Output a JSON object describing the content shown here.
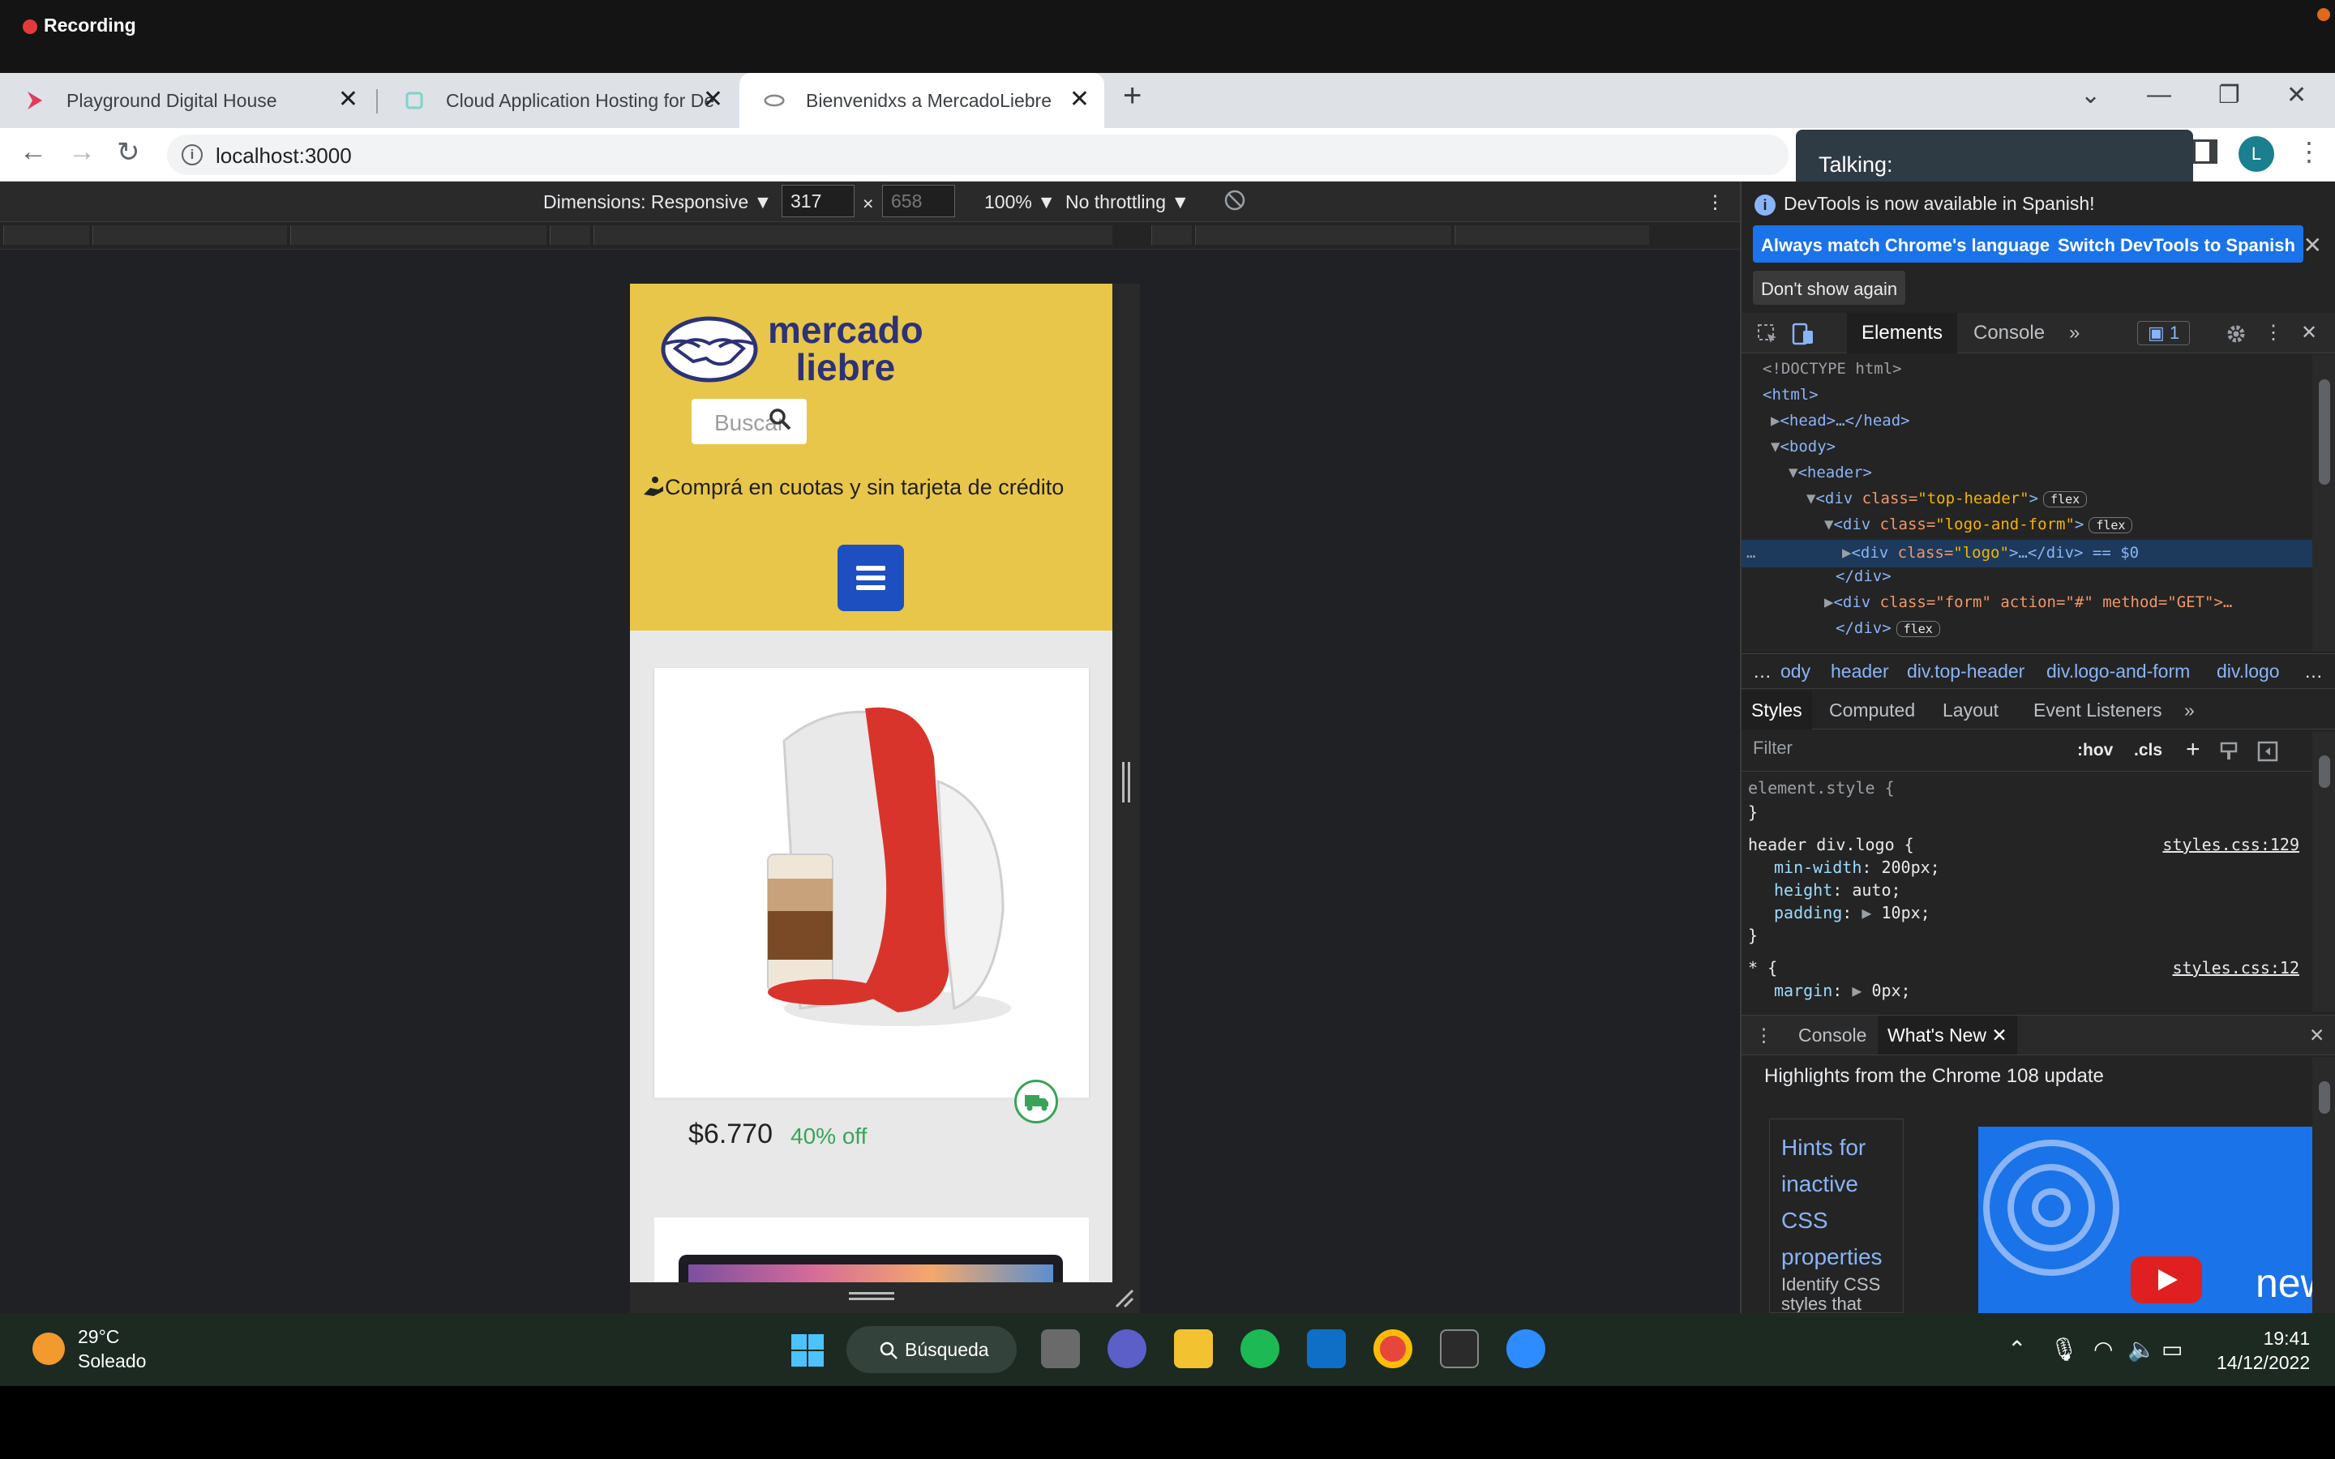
{
  "recording": {
    "label": "Recording"
  },
  "tabs": [
    {
      "label": "Playground Digital House",
      "close": "✕"
    },
    {
      "label": "Cloud Application Hosting for De",
      "close": "✕"
    },
    {
      "label": "Bienvenidxs a MercadoLiebre",
      "close": "✕"
    }
  ],
  "new_tab": "+",
  "window_controls": {
    "chevron": "⌄",
    "minimize": "—",
    "maximize": "❐",
    "close": "✕"
  },
  "address": {
    "url": "localhost:3000",
    "info": "i",
    "profile": "L",
    "menu": "⋮"
  },
  "nav": {
    "back": "←",
    "forward": "→",
    "reload": "↻"
  },
  "talking": {
    "label": "Talking:"
  },
  "device_toolbar": {
    "dimensions": "Dimensions: Responsive ▼",
    "width": "317",
    "height": "658",
    "times": "×",
    "zoom": "100% ▼",
    "throttling": "No throttling ▼",
    "more": "⋮"
  },
  "page": {
    "logo_line1": "mercado",
    "logo_line2": "liebre",
    "search_placeholder": "Buscar",
    "cuotas": "Comprá en cuotas y sin tarjeta de crédito",
    "product": {
      "price": "$6.770",
      "discount": "40% off"
    }
  },
  "devtools": {
    "info": "DevTools is now available in Spanish!",
    "btn_match": "Always match Chrome's language",
    "btn_switch": "Switch DevTools to Spanish",
    "btn_dont": "Don't show again",
    "close": "✕",
    "tabs": {
      "elements": "Elements",
      "console": "Console",
      "more": "»",
      "issues": "1"
    },
    "dom": {
      "doctype": "<!DOCTYPE html>",
      "html": "<html>",
      "head": "<head>…</head>",
      "body": "<body>",
      "header": "<header>",
      "top_header_tag": "<div ",
      "top_header_attr": "class=",
      "top_header_val": "\"top-header\"",
      "logo_form_val": "\"logo-and-form\"",
      "logo_val": "\"logo\"",
      "logo_tail": ">…</div> == $0",
      "close_div": "</div>",
      "form_attrs": "class=\"form\" action=\"#\" method=\"GET\">…",
      "flex": "flex"
    },
    "breadcrumb": [
      "…",
      "ody",
      "header",
      "div.top-header",
      "div.logo-and-form",
      "div.logo",
      "…"
    ],
    "styles_tabs": {
      "styles": "Styles",
      "computed": "Computed",
      "layout": "Layout",
      "events": "Event Listeners",
      "more": "»"
    },
    "filter": {
      "placeholder": "Filter",
      "hov": ":hov",
      "cls": ".cls",
      "plus": "+"
    },
    "css": {
      "element_style": "element.style {",
      "close_brace": "}",
      "rule_selector": "header div.logo {",
      "rule_source": "styles.css:129",
      "p1": "min-width",
      "v1": "200px;",
      "p2": "height",
      "v2": "auto;",
      "p3": "padding",
      "v3": "10px;",
      "star": "* {",
      "star_source": "styles.css:12",
      "p4": "margin",
      "v4": "0px;"
    },
    "drawer": {
      "console": "Console",
      "whats_new": "What's New",
      "close": "✕"
    },
    "whats_new": {
      "highlights": "Highlights from the Chrome 108 update",
      "hint_title_1": "Hints for",
      "hint_title_2": "inactive",
      "hint_title_3": "CSS",
      "hint_title_4": "properties",
      "hint_sub_1": "Identify CSS",
      "hint_sub_2": "styles that",
      "video_text": "new"
    }
  },
  "taskbar": {
    "temp": "29°C",
    "weather": "Soleado",
    "search": "Búsqueda",
    "time": "19:41",
    "date": "14/12/2022"
  }
}
